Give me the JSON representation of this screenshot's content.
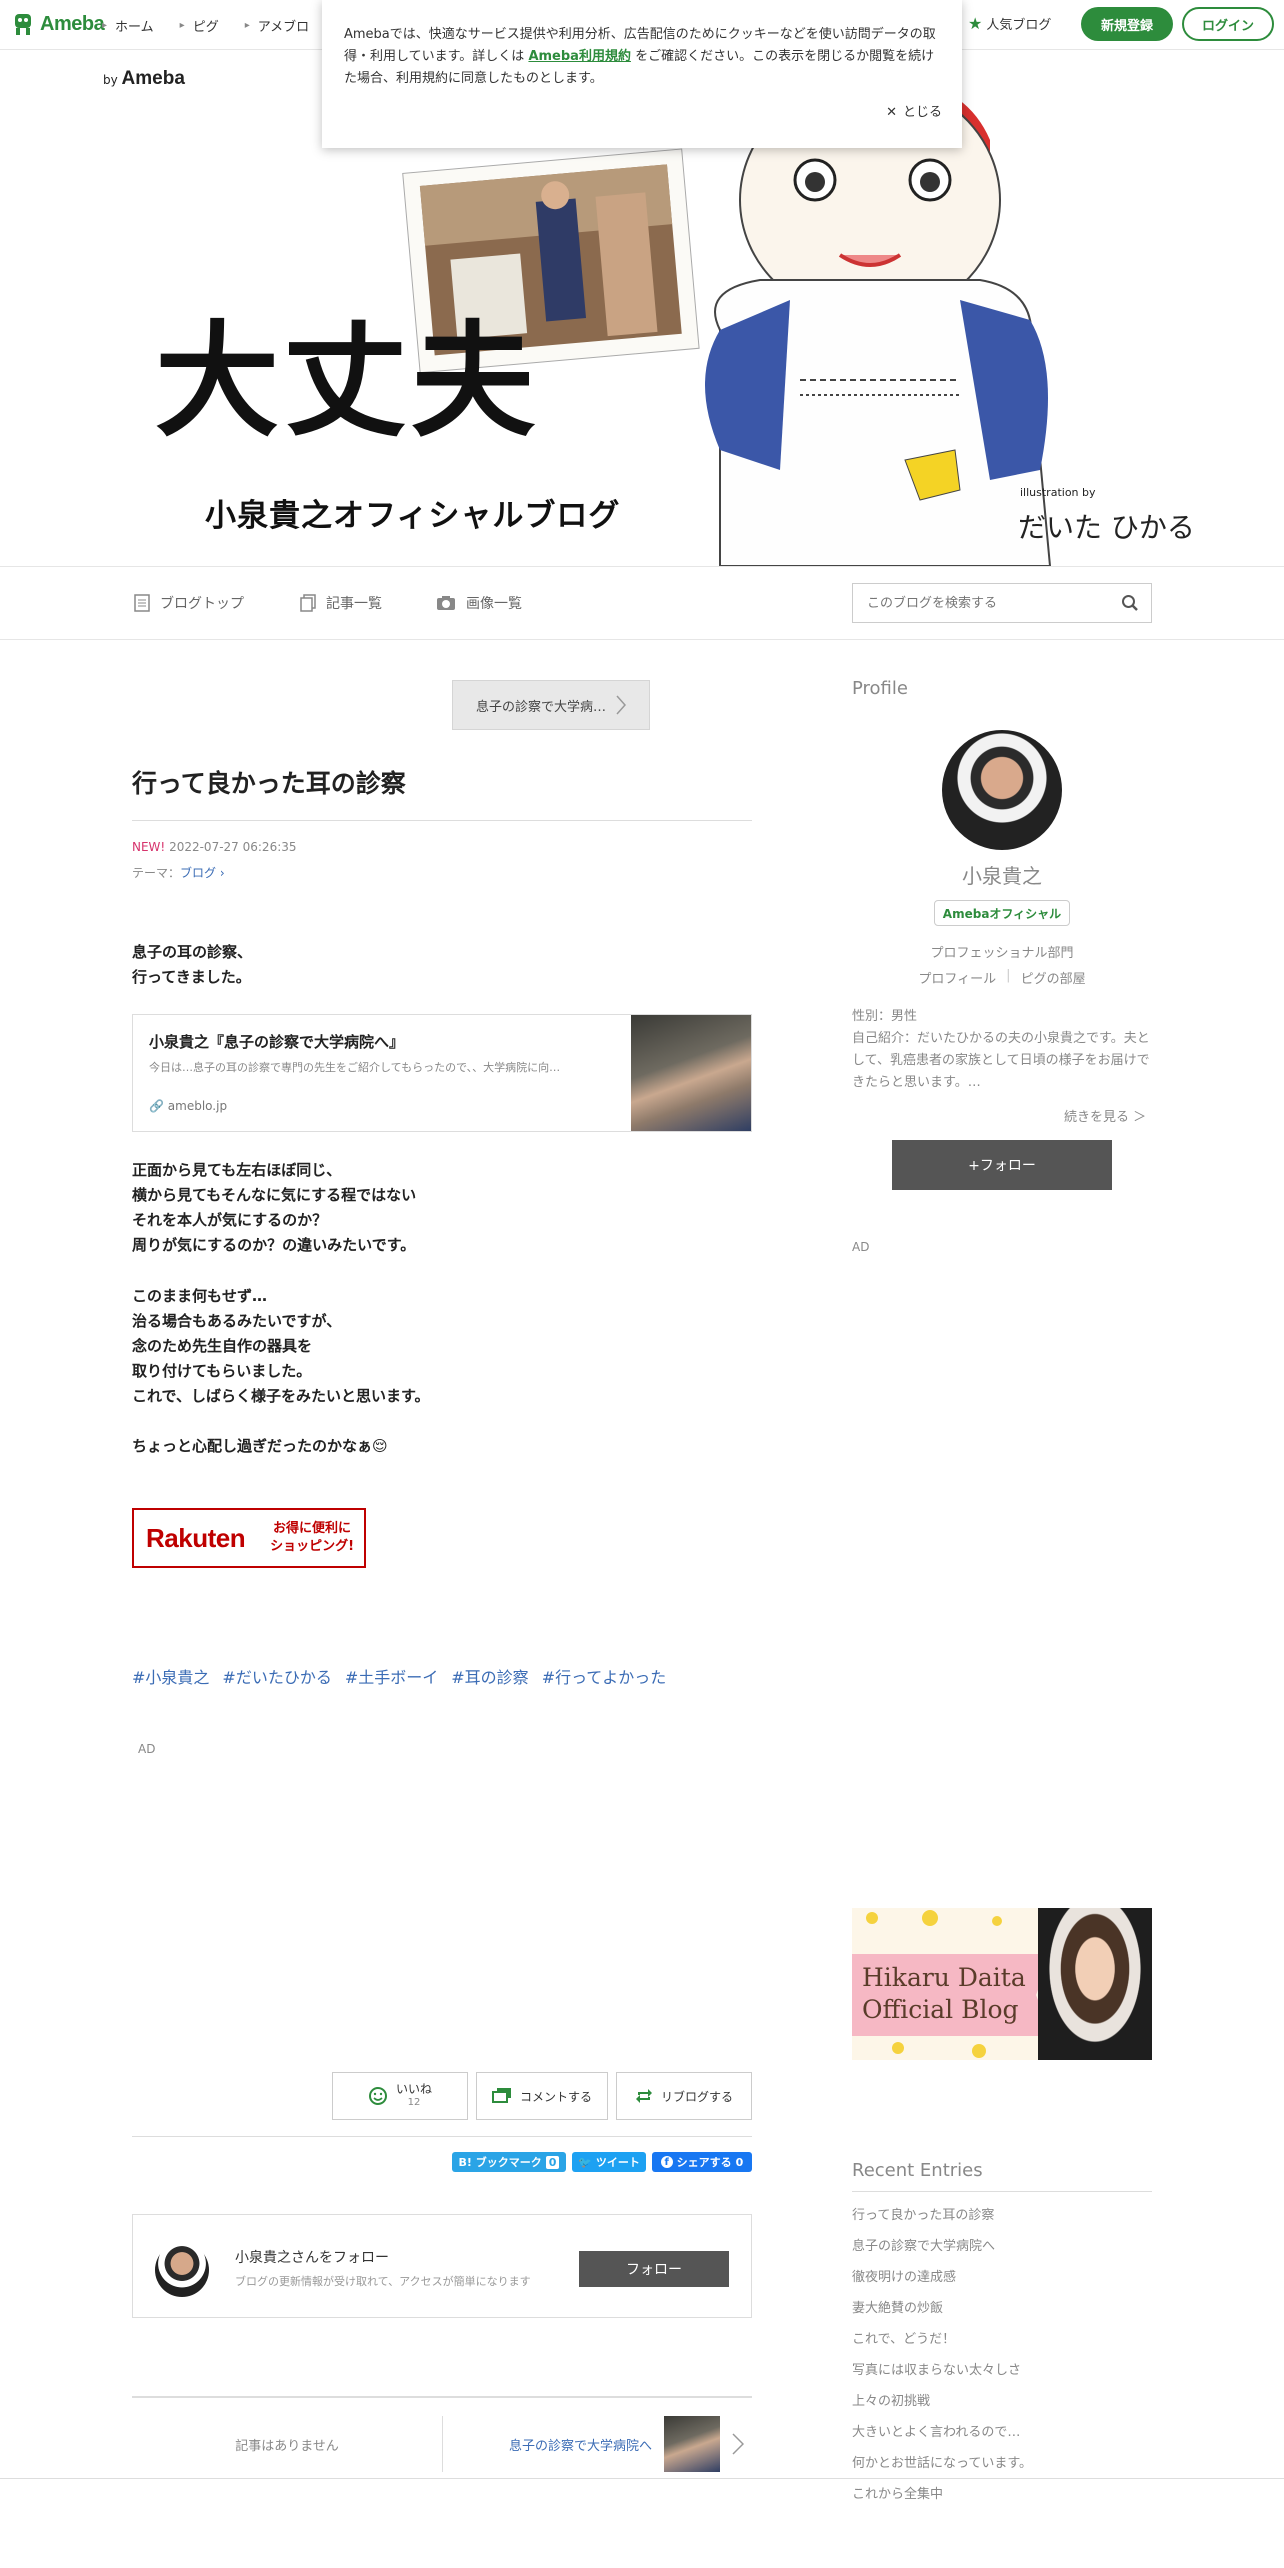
{
  "header": {
    "logo": "Ameba",
    "nav": [
      "ホーム",
      "ピグ",
      "アメブロ"
    ],
    "popular": "人気ブログ",
    "signup": "新規登録",
    "login": "ログイン"
  },
  "cookie": {
    "text_before": "Amebaでは、快適なサービス提供や利用分析、広告配信のためにクッキーなどを使い訪問データの取得・利用しています。詳しくは",
    "link": "Ameba利用規約",
    "text_after": "をご確認ください。この表示を閉じるか閲覧を続けた場合、利用規約に同意したものとします。",
    "close": "とじる"
  },
  "banner": {
    "by": "by",
    "by_brand": "Ameba",
    "title": "大丈夫",
    "subtitle": "小泉貴之オフィシャルブログ",
    "illustration_by": "illustration by",
    "illustrator": "だいた ひかる"
  },
  "subnav": {
    "blog_top": "ブログトップ",
    "articles": "記事一覧",
    "images": "画像一覧",
    "search_placeholder": "このブログを検索する"
  },
  "article": {
    "next_link": "息子の診察で大学病…",
    "title": "行って良かった耳の診察",
    "new_label": "NEW!",
    "date": "2022-07-27 06:26:35",
    "theme_label": "テーマ：",
    "theme": "ブログ",
    "para1": "息子の耳の診察、\n行ってきました。",
    "card_title": "小泉貴之『息子の診察で大学病院へ』",
    "card_desc": "今日は…息子の耳の診察で専門の先生をご紹介してもらったので、、大学病院に向…",
    "card_url": "ameblo.jp",
    "para2": "正面から見ても左右ほぼ同じ、\n横から見てもそんなに気にする程ではない\nそれを本人が気にするのか？\n周りが気にするのか？の違いみたいです。",
    "para3": "このまま何もせず…\n治る場合もあるみたいですが、\n念のため先生自作の器具を\n取り付けてもらいました。\nこれで、しばらく様子をみたいと思います。",
    "para4": "ちょっと心配し過ぎだったのかなぁ",
    "emoji": "😌",
    "rakuten_logo": "Rakuten",
    "rakuten_copy1": "お得に便利に",
    "rakuten_copy2": "ショッピング!",
    "tags": [
      "#小泉貴之",
      "#だいたひかる",
      "#土手ボーイ",
      "#耳の診察",
      "#行ってよかった"
    ],
    "ad": "AD",
    "like": "いいね",
    "like_count": "12",
    "comment": "コメントする",
    "reblog": "リブログする",
    "bookmark": "B! ブックマーク",
    "bookmark_count": "0",
    "tweet": "ツイート",
    "share": "シェアする",
    "share_count": "0",
    "follow_name": "小泉貴之さんをフォロー",
    "follow_desc": "ブログの更新情報が受け取れて、アクセスが簡単になります",
    "follow_button": "フォロー",
    "prev_none": "記事はありません",
    "next_entry": "息子の診察で大学病院へ"
  },
  "sidebar": {
    "profile_heading": "Profile",
    "name": "小泉貴之",
    "official": "Amebaオフィシャル",
    "dept": "プロフェッショナル部門",
    "link_profile": "プロフィール",
    "link_pig": "ピグの部屋",
    "intro": "性別：男性\n自己紹介：だいたひかるの夫の小泉貴之です。夫として、乳癌患者の家族として日頃の様子をお届けできたらと思います。…",
    "more": "続きを見る ＞",
    "follow": "+フォロー",
    "ad": "AD",
    "daita_title1": "Hikaru Daita",
    "daita_title2": "Official Blog",
    "recent_heading": "Recent Entries",
    "recent": [
      "行って良かった耳の診察",
      "息子の診察で大学病院へ",
      "徹夜明けの達成感",
      "妻大絶賛の炒飯",
      "これで、どうだ！",
      "写真には収まらない太々しさ",
      "上々の初挑戦",
      "大きいとよく言われるので…",
      "何かとお世話になっています。",
      "これから全集中"
    ]
  }
}
